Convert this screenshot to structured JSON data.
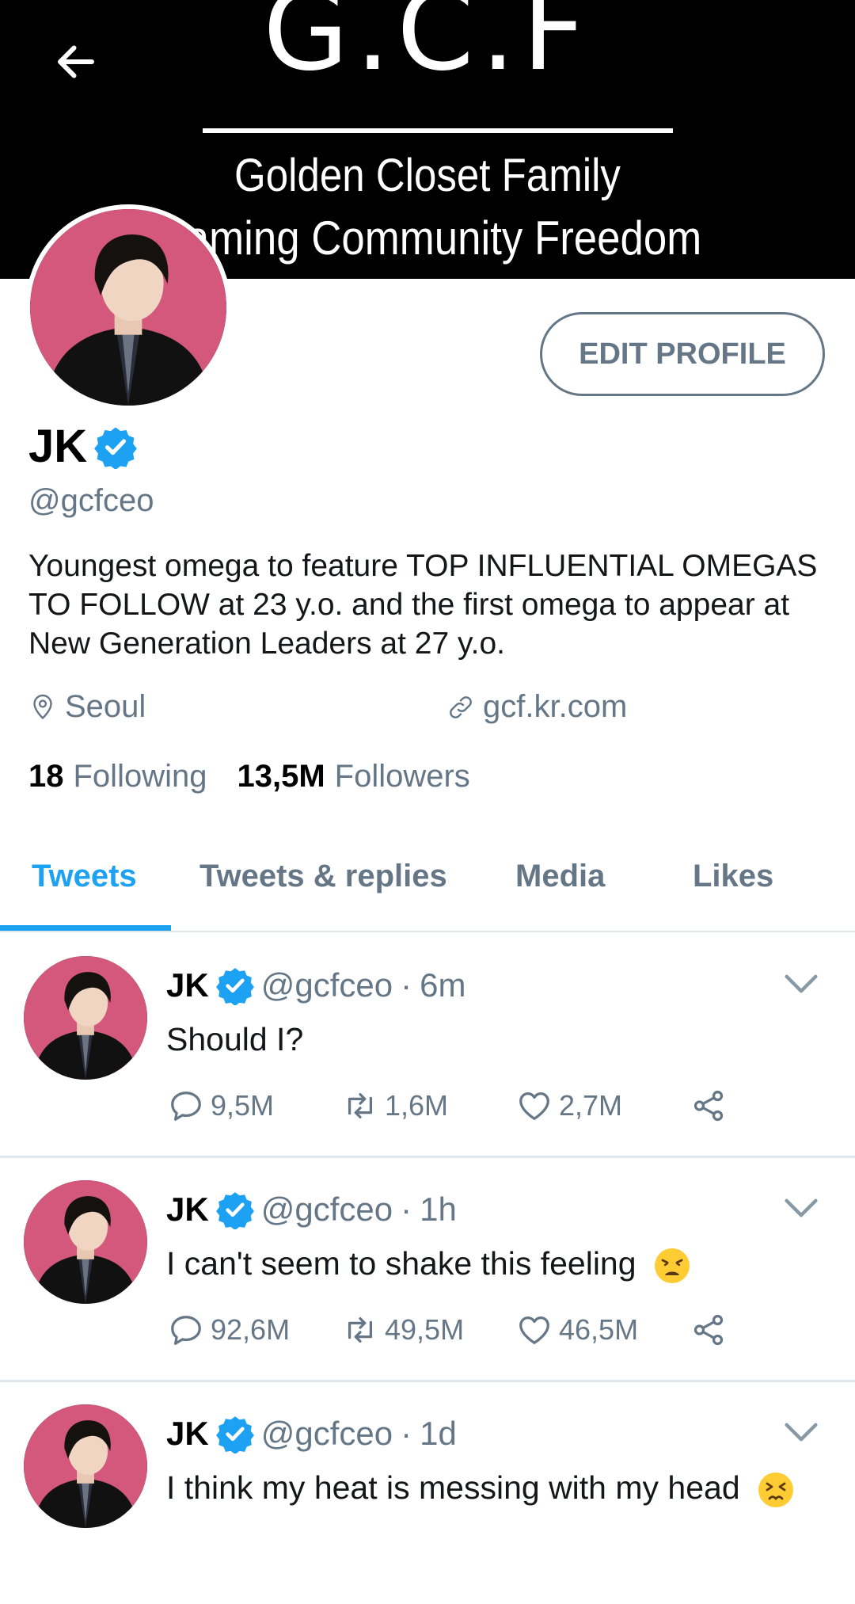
{
  "banner": {
    "title": "G.C.F",
    "line1": "Golden Closet Family",
    "line2": "Gaming Community Freedom"
  },
  "header": {
    "back_icon": "arrow-left-icon"
  },
  "profile": {
    "edit_label": "EDIT PROFILE",
    "name": "JK",
    "handle": "@gcfceo",
    "bio": "Youngest omega to feature TOP INFLUENTIAL OMEGAS TO FOLLOW at 23 y.o. and the first omega to appear at New Generation Leaders at 27 y.o.",
    "location": "Seoul",
    "website": "gcf.kr.com",
    "following_count": "18",
    "following_label": "Following",
    "followers_count": "13,5M",
    "followers_label": "Followers"
  },
  "tabs": [
    {
      "label": "Tweets",
      "active": true
    },
    {
      "label": "Tweets & replies"
    },
    {
      "label": "Media"
    },
    {
      "label": "Likes"
    }
  ],
  "tweets": [
    {
      "name": "JK",
      "handle": "@gcfceo",
      "dot": "·",
      "time": "6m",
      "text": "Should I?",
      "emoji": "",
      "replies": "9,5M",
      "retweets": "1,6M",
      "likes": "2,7M"
    },
    {
      "name": "JK",
      "handle": "@gcfceo",
      "dot": "·",
      "time": "1h",
      "text": "I can't seem to shake this feeling",
      "emoji": "weary-face",
      "replies": "92,6M",
      "retweets": "49,5M",
      "likes": "46,5M"
    },
    {
      "name": "JK",
      "handle": "@gcfceo",
      "dot": "·",
      "time": "1d",
      "text": "I think my heat is messing with my head",
      "emoji": "persevering-face",
      "replies": "",
      "retweets": "",
      "likes": ""
    }
  ],
  "colors": {
    "accent": "#1da1f2",
    "muted": "#657786",
    "avatar_bg": "#d4577c"
  }
}
